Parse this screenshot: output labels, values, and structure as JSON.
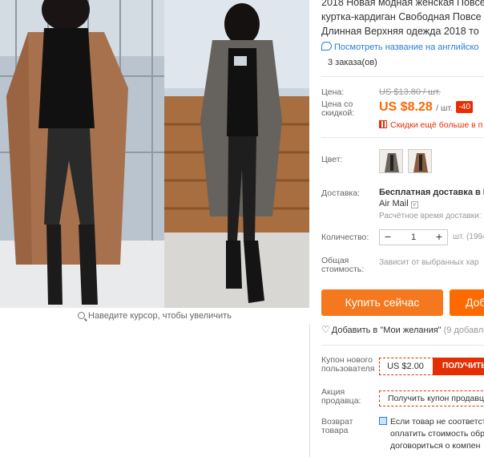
{
  "gallery": {
    "zoom_hint": "Наведите курсор, чтобы увеличить"
  },
  "product": {
    "title_lines": [
      "2018 Новая модная женская Повсе",
      "куртка-кардиган Свободная Повсе",
      "Длинная Верхняя одежда 2018 то"
    ],
    "translate_link": "Посмотреть название на английско",
    "orders": "3 заказа(ов)"
  },
  "price": {
    "label": "Цена:",
    "old_price": "US $13.80 / шт.",
    "discount_label_1": "Цена со",
    "discount_label_2": "скидкой:",
    "new_price": "US $8.28",
    "per_unit": "/ шт.",
    "discount_badge": "-40",
    "app_deal": "Скидки ещё больше в п"
  },
  "color": {
    "label": "Цвет:",
    "swatches": [
      "gray",
      "brown"
    ]
  },
  "shipping": {
    "label": "Доставка:",
    "line1": "Бесплатная доставка в Ru",
    "line2": "Air Mail",
    "estimate": "Расчётное время доставки:"
  },
  "quantity": {
    "label": "Количество:",
    "minus": "−",
    "value": "1",
    "plus": "+",
    "units": "шт. (1994"
  },
  "total": {
    "label_1": "Общая",
    "label_2": "стоимость:",
    "value": "Зависит от выбранных хар"
  },
  "actions": {
    "buy_now": "Купить сейчас",
    "add_to_cart": "Доб",
    "wishlist": "Добавить в \"Мои желания\"",
    "wishlist_count": "(9 добавле"
  },
  "coupons": {
    "new_user_label_1": "Купон нового",
    "new_user_label_2": "пользователя",
    "new_user_amount": "US $2.00",
    "new_user_get": "ПОЛУЧИТЬ",
    "seller_label_1": "Акция",
    "seller_label_2": "продавца:",
    "seller_coupon": "Получить купон продавц"
  },
  "returns": {
    "label_1": "Возврат",
    "label_2": "товара",
    "lines": [
      "Если товар не соответст",
      "оплатить стоимость обр",
      "договориться о компен"
    ]
  },
  "colors": {
    "accent": "#f6781e",
    "price": "#ff6600",
    "deal_red": "#e62e04",
    "link_blue": "#2a7dd6"
  }
}
